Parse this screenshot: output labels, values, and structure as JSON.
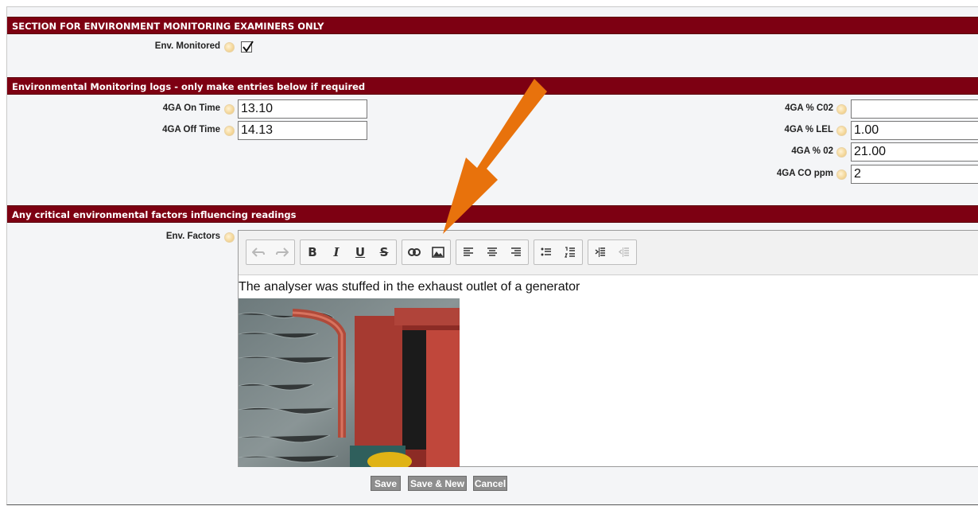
{
  "sections": {
    "examiners": "SECTION FOR ENVIRONMENT MONITORING EXAMINERS ONLY",
    "logs": "Environmental Monitoring logs - only make entries below if required",
    "factors": "Any critical environmental factors influencing readings"
  },
  "fields": {
    "env_monitored": {
      "label": "Env. Monitored",
      "checked": true
    },
    "on_time": {
      "label": "4GA On Time",
      "value": "13.10"
    },
    "off_time": {
      "label": "4GA Off Time",
      "value": "14.13"
    },
    "co2": {
      "label": "4GA % C02",
      "value": ""
    },
    "lel": {
      "label": "4GA % LEL",
      "value": "1.00"
    },
    "o2": {
      "label": "4GA % 02",
      "value": "21.00"
    },
    "co_ppm": {
      "label": "4GA CO ppm",
      "value": "2"
    },
    "env_factors": {
      "label": "Env. Factors",
      "text": "The analyser was stuffed in the exhaust outlet of a generator"
    }
  },
  "toolbar": {
    "undo_icon": "undo-icon",
    "redo_icon": "redo-icon",
    "bold": "B",
    "italic": "I",
    "underline": "U",
    "strike": "S",
    "link_icon": "link-icon",
    "image_icon": "image-icon",
    "align_icons": [
      "align-left-icon",
      "align-center-icon",
      "align-right-icon"
    ],
    "list_icons": [
      "bullet-list-icon",
      "numbered-list-icon"
    ],
    "indent_icons": [
      "indent-icon",
      "outdent-icon"
    ]
  },
  "buttons": {
    "save": "Save",
    "save_new": "Save & New",
    "cancel": "Cancel"
  },
  "colors": {
    "band": "#7d0012",
    "arrow": "#e8720c",
    "button": "#8e8e8e"
  }
}
